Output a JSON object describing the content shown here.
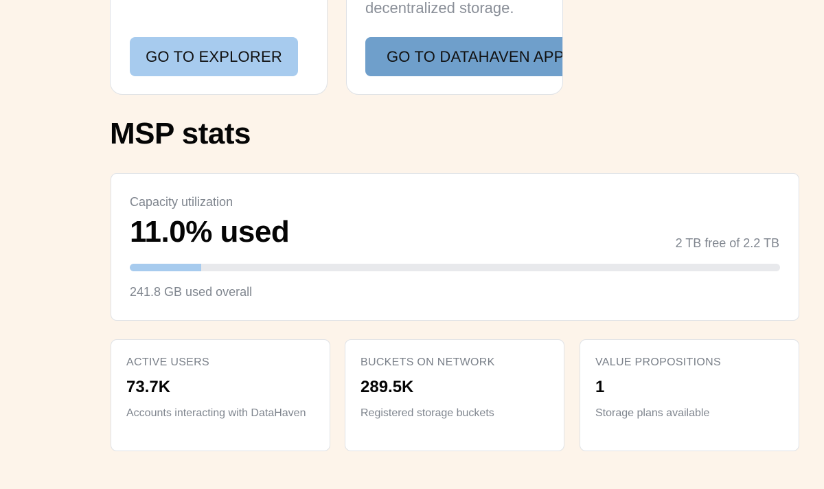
{
  "cards": {
    "explorer": {
      "button_label": "GO TO EXPLORER"
    },
    "datahaven_app": {
      "description": "decentralized storage.",
      "button_label": "GO TO DATAHAVEN APP"
    }
  },
  "msp_stats": {
    "title": "MSP stats",
    "capacity": {
      "label": "Capacity utilization",
      "used_text": "11.0% used",
      "free_text": "2 TB free of 2.2 TB",
      "used_percent": 11.0,
      "overall_text": "241.8 GB used overall"
    },
    "stats": [
      {
        "label": "ACTIVE USERS",
        "value": "73.7K",
        "description": "Accounts interacting with DataHaven"
      },
      {
        "label": "BUCKETS ON NETWORK",
        "value": "289.5K",
        "description": "Registered storage buckets"
      },
      {
        "label": "VALUE PROPOSITIONS",
        "value": "1",
        "description": "Storage plans available"
      }
    ]
  },
  "colors": {
    "page_background": "#fdf4ea",
    "accent_light_blue": "#a7cbee",
    "accent_dark_blue": "#6f9fcb",
    "progress_track": "#e8e9ec"
  }
}
